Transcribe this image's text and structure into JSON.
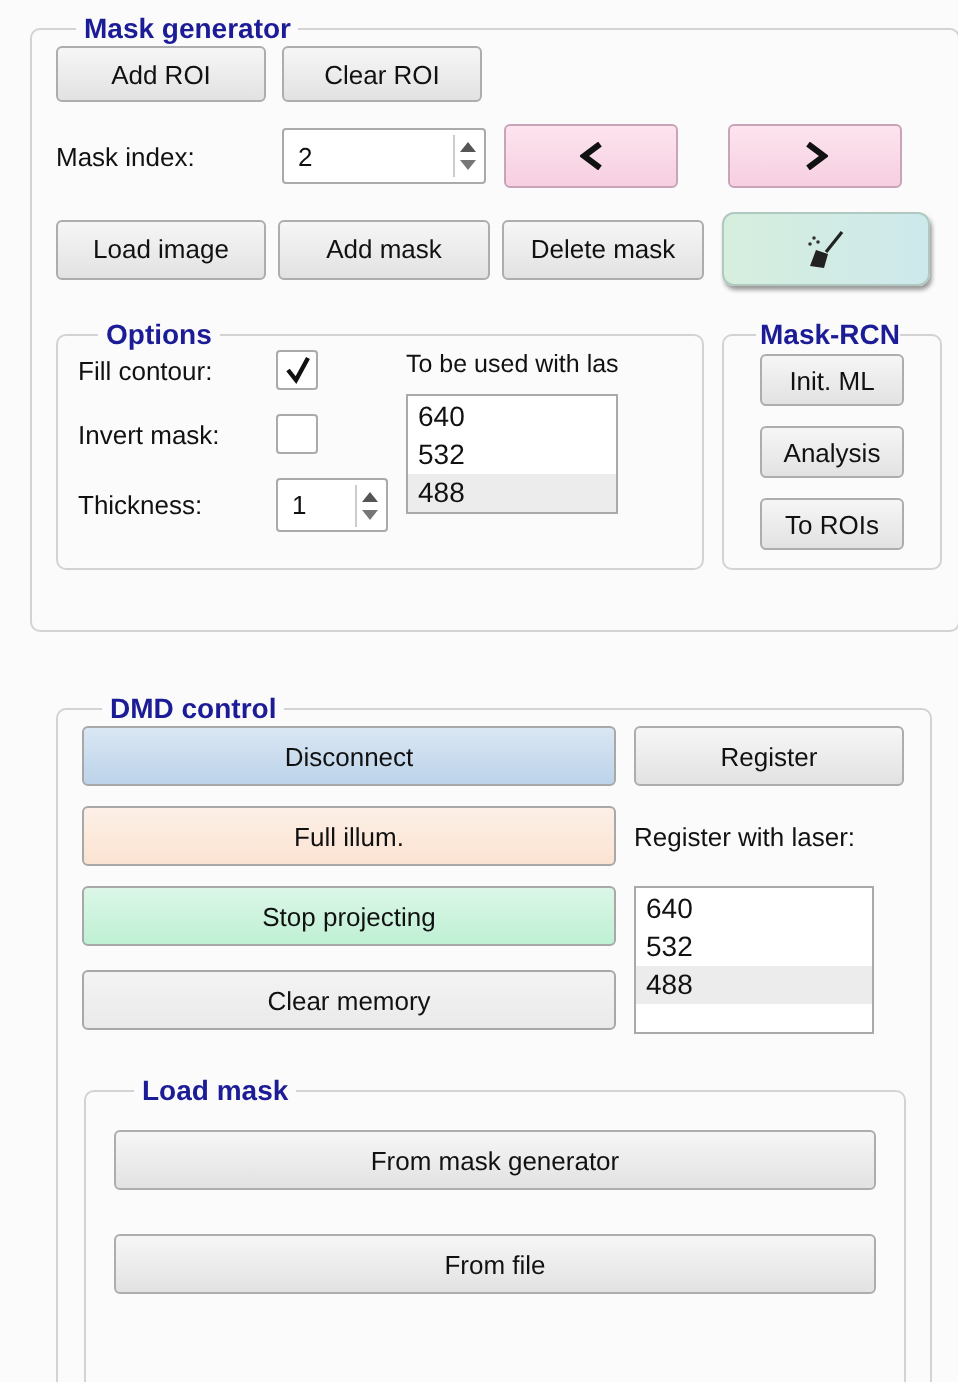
{
  "mask_generator": {
    "title": "Mask generator",
    "roi_buttons": [
      "Add ROI",
      "Clear ROI"
    ],
    "mask_index": {
      "label": "Mask index:",
      "value": "2"
    },
    "nav_buttons": [
      {
        "kind": "prev"
      },
      {
        "kind": "next"
      }
    ],
    "action_buttons": [
      "Load image",
      "Add mask",
      "Delete mask"
    ],
    "options": {
      "title": "Options",
      "fill_contour": {
        "label": "Fill contour:",
        "checked": true
      },
      "invert_mask": {
        "label": "Invert mask:",
        "checked": false
      },
      "thickness": {
        "label": "Thickness:",
        "value": "1"
      },
      "laser_label": "To be used with las",
      "lasers": [
        {
          "label": "640",
          "selected": false
        },
        {
          "label": "532",
          "selected": false
        },
        {
          "label": "488",
          "selected": true
        }
      ]
    },
    "mask_rcn": {
      "title": "Mask-RCN",
      "buttons": [
        "Init. ML",
        "Analysis",
        "To ROIs"
      ]
    }
  },
  "dmd_control": {
    "title": "DMD control",
    "buttons": [
      {
        "label": "Disconnect",
        "color": "#bcd3ea"
      },
      {
        "label": "Full illum.",
        "color": "#fbe3d2"
      },
      {
        "label": "Stop projecting",
        "color": "#bff0d4"
      },
      {
        "label": "Clear memory",
        "color": "#eaeaea"
      }
    ],
    "register_button": "Register",
    "register_label": "Register with laser:",
    "lasers": [
      {
        "label": "640",
        "selected": false
      },
      {
        "label": "532",
        "selected": false
      },
      {
        "label": "488",
        "selected": true
      }
    ],
    "load_mask": {
      "title": "Load mask",
      "buttons": [
        "From mask generator",
        "From file"
      ]
    }
  }
}
